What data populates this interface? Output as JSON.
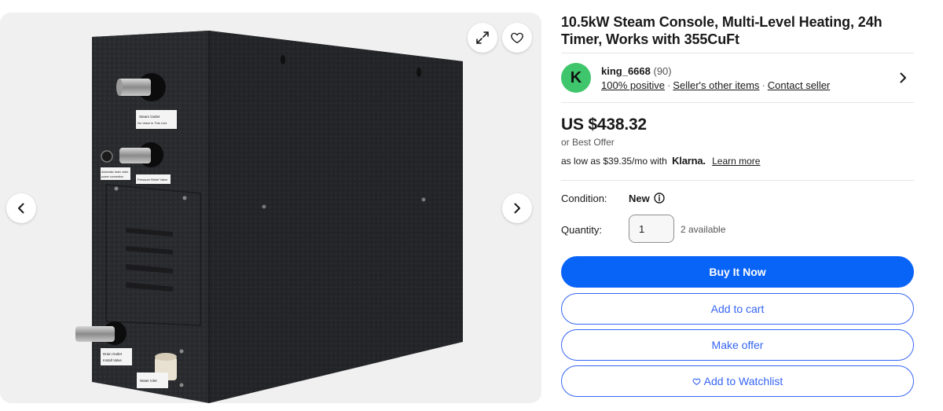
{
  "product": {
    "title": "10.5kW Steam Console, Multi-Level Heating, 24h Timer, Works with 355CuFt",
    "image_labels": {
      "steam_outlet_1": "Steam Outlet",
      "steam_outlet_2": "No Valve in This Line",
      "pressure_relief": "Pressure Relief Valve",
      "auto_drain_1": "Automatic drain valve",
      "auto_drain_2": "power connection",
      "drain_outlet_1": "Drain Outlet",
      "drain_outlet_2": "Install Valve",
      "water_inlet": "Water Inlet"
    }
  },
  "gallery": {
    "icons": {
      "expand": "expand-icon",
      "watch": "heart-icon",
      "prev": "chevron-left-icon",
      "next": "chevron-right-icon"
    }
  },
  "seller": {
    "avatar_letter": "K",
    "name": "king_6668",
    "feedback_count": "(90)",
    "positive": "100% positive",
    "other_items": "Seller's other items",
    "contact": "Contact seller",
    "avatar_color": "#3fc56b"
  },
  "pricing": {
    "price": "US $438.32",
    "best_offer": "or Best Offer",
    "klarna_prefix": "as low as $39.35/mo with",
    "klarna_brand": "Klarna.",
    "klarna_link": "Learn more"
  },
  "details": {
    "condition_label": "Condition:",
    "condition_value": "New",
    "quantity_label": "Quantity:",
    "quantity_value": "1",
    "available": "2 available"
  },
  "actions": {
    "buy_now": "Buy It Now",
    "add_to_cart": "Add to cart",
    "make_offer": "Make offer",
    "watchlist": "Add to Watchlist"
  },
  "colors": {
    "primary": "#0863f7",
    "secondary_text": "#3665f3",
    "gallery_bg": "#f0f0f0"
  }
}
